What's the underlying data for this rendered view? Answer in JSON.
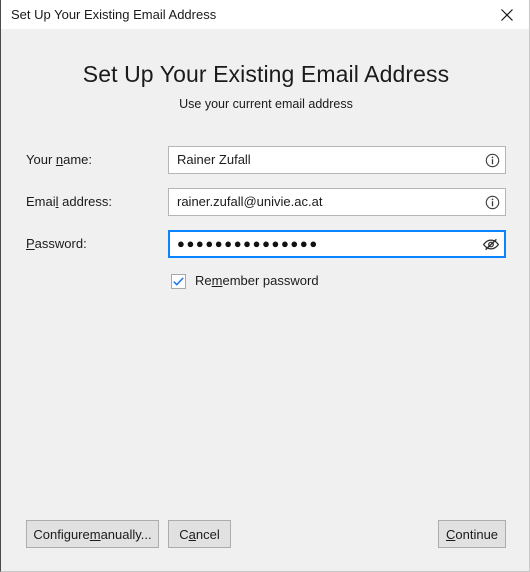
{
  "window": {
    "title": "Set Up Your Existing Email Address",
    "close_icon": "close-icon"
  },
  "header": {
    "heading": "Set Up Your Existing Email Address",
    "subheading": "Use your current email address"
  },
  "form": {
    "name": {
      "label_pre": "Your ",
      "label_acc": "n",
      "label_post": "ame:",
      "value": "Rainer Zufall",
      "icon": "info-icon"
    },
    "email": {
      "label_pre": "Emai",
      "label_acc": "l",
      "label_post": " address:",
      "value": "rainer.zufall@univie.ac.at",
      "icon": "info-icon"
    },
    "password": {
      "label_pre": "",
      "label_acc": "P",
      "label_post": "assword:",
      "value": "●●●●●●●●●●●●●●●",
      "icon": "eye-slash-icon",
      "focused": true
    },
    "remember": {
      "label_pre": "Re",
      "label_acc": "m",
      "label_post": "ember password",
      "checked": true,
      "check_color": "#1a73e8"
    }
  },
  "buttons": {
    "configure": {
      "pre": "Configure ",
      "acc": "m",
      "post": "anually..."
    },
    "cancel": {
      "pre": "C",
      "acc": "a",
      "post": "ncel"
    },
    "continue": {
      "pre": "",
      "acc": "C",
      "post": "ontinue"
    }
  },
  "colors": {
    "window_bg": "#f0f0f0",
    "titlebar_bg": "#ffffff",
    "input_bg": "#ffffff",
    "input_border": "#b5b5b5",
    "focus_border": "#0a84ff",
    "button_bg": "#e1e1e1",
    "button_border": "#adadad",
    "text": "#1b1b1b"
  }
}
